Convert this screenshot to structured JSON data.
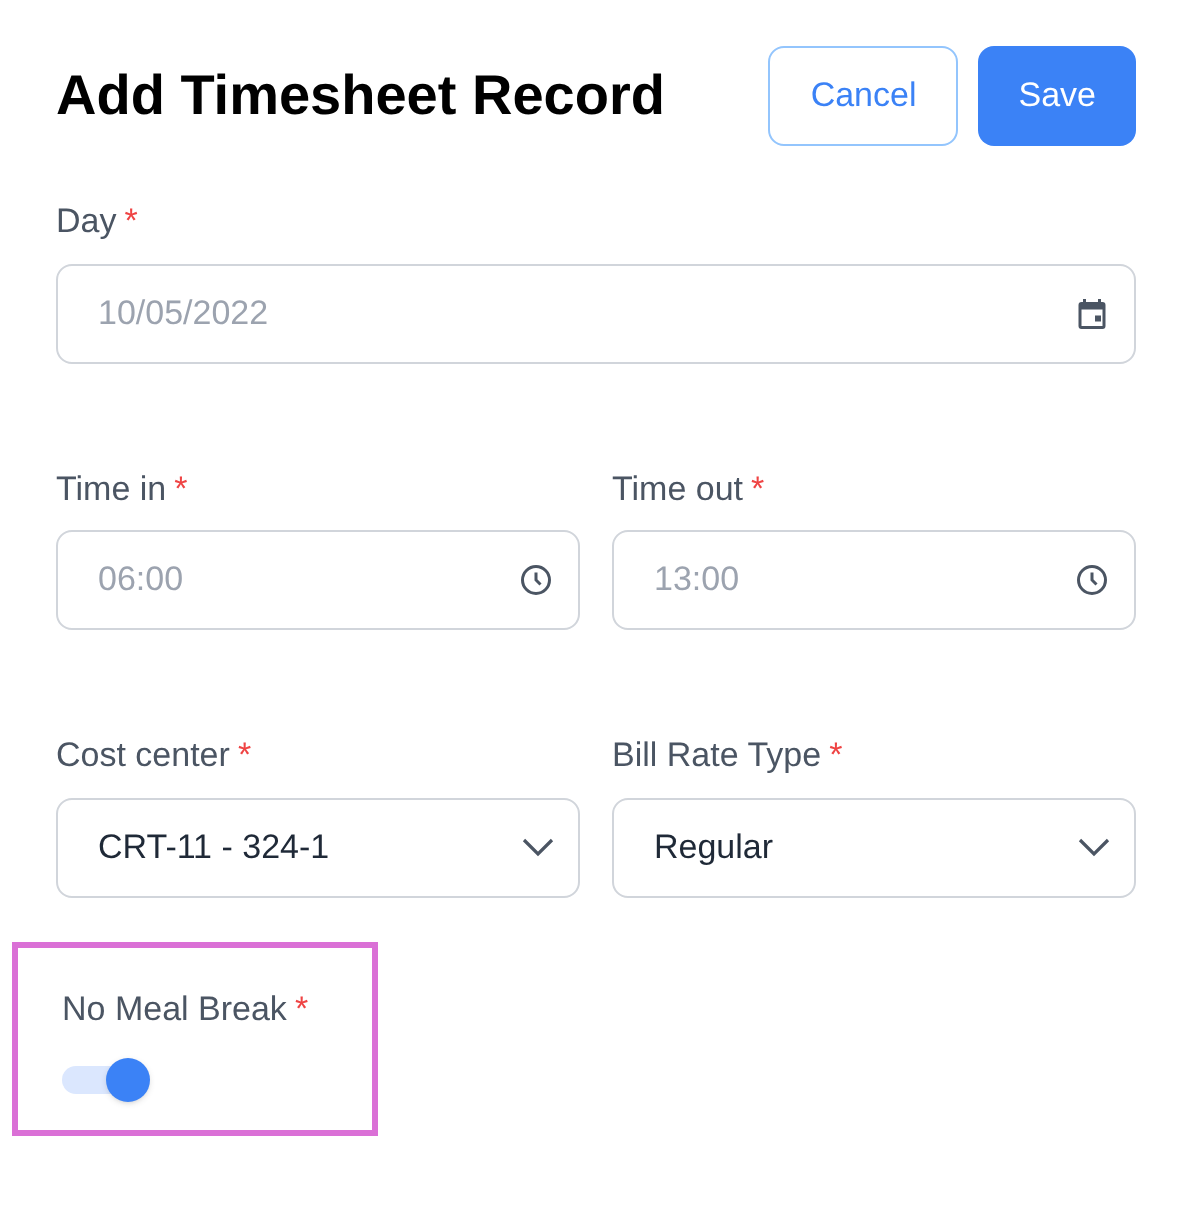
{
  "title": "Add Timesheet Record",
  "buttons": [
    {
      "label": "Cancel",
      "kind": "outline"
    },
    {
      "label": "Save",
      "kind": "primary"
    }
  ],
  "rows": [
    [
      {
        "label": "Day",
        "required": true,
        "kind": "date",
        "value": "10/05/2022"
      }
    ],
    [
      {
        "label": "Time in",
        "required": true,
        "kind": "time",
        "value": "06:00"
      },
      {
        "label": "Time out",
        "required": true,
        "kind": "time",
        "value": "13:00"
      }
    ],
    [
      {
        "label": "Cost center",
        "required": true,
        "kind": "select",
        "value": "CRT-11 - 324-1"
      },
      {
        "label": "Bill Rate Type",
        "required": true,
        "kind": "select",
        "value": "Regular"
      }
    ]
  ],
  "toggle": {
    "label": "No Meal Break",
    "required": true,
    "on": true,
    "highlighted": true
  },
  "required_mark": "*"
}
